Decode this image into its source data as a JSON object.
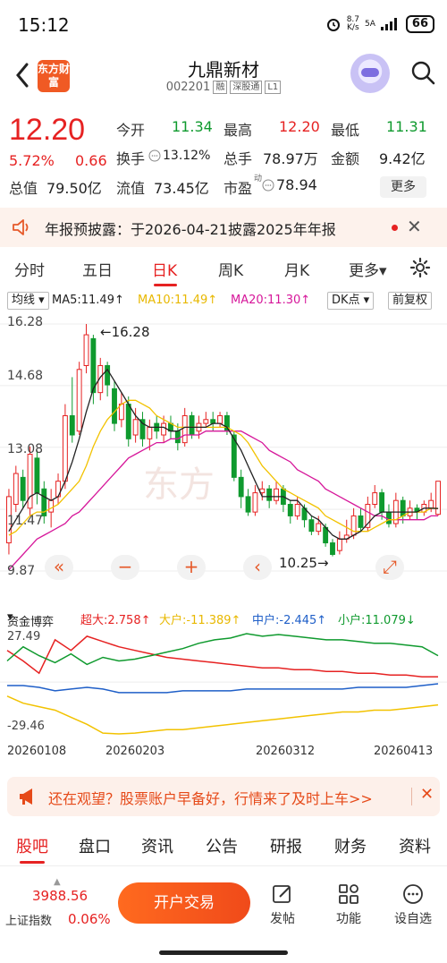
{
  "status_bar": {
    "time": "15:12",
    "net_speed_value": "8.7",
    "net_speed_unit": "K/s",
    "signal": "5A",
    "battery": "66"
  },
  "header": {
    "logo_text": "东方财富",
    "stock_name": "九鼎新材",
    "stock_code": "002201",
    "tags": [
      "融",
      "深股通",
      "L1"
    ]
  },
  "quote": {
    "price": "12.20",
    "change_pct": "5.72%",
    "change": "0.66",
    "total_cap_label": "总值",
    "total_cap": "79.50亿",
    "float_cap_label": "流值",
    "float_cap": "73.45亿",
    "open_label": "今开",
    "open": "11.34",
    "turnover_label": "换手",
    "turnover": "13.12%",
    "pe_label": "市盈",
    "pe_superscript": "动",
    "pe": "78.94",
    "high_label": "最高",
    "high": "12.20",
    "volume_label": "总手",
    "volume": "78.97万",
    "low_label": "最低",
    "low": "11.31",
    "amount_label": "金额",
    "amount": "9.42亿",
    "more_label": "更多"
  },
  "notice": {
    "text": "年报预披露：于2026-04-21披露2025年年报",
    "close_icon": "close-icon"
  },
  "chart_tabs": {
    "items": [
      "分时",
      "五日",
      "日K",
      "周K",
      "月K",
      "更多▾"
    ],
    "active": "日K"
  },
  "indicators": {
    "ma_type": "均线",
    "ma5": "MA5:11.49↑",
    "ma10": "MA10:11.49↑",
    "ma20": "MA20:11.30↑",
    "dk_label": "DK点",
    "adjust_label": "前复权"
  },
  "colors": {
    "up": "#e62222",
    "down": "#0f9a2e",
    "ma5": "#222222",
    "ma10": "#f2c200",
    "ma20": "#d6179a",
    "accent": "#f05a24"
  },
  "kline_axis": {
    "y_labels": [
      "16.28",
      "14.68",
      "13.08",
      "11.47",
      "9.87"
    ],
    "high_marker": "16.28",
    "low_marker": "10.25"
  },
  "chart_controls": [
    "«",
    "−",
    "+",
    "‹",
    "⤢"
  ],
  "fund_flow": {
    "title": "资金博弈",
    "super_large": "超大:2.758↑",
    "large": "大户:-11.389↑",
    "medium": "中户:-2.445↑",
    "small": "小户:11.079↓",
    "y_labels": [
      "27.49",
      "-29.46"
    ]
  },
  "dates": [
    "20260108",
    "20260203",
    "20260312",
    "20260413"
  ],
  "chart_data": [
    {
      "type": "candlestick",
      "title": "日K",
      "ylim": [
        9.87,
        16.28
      ],
      "y_ticks": [
        16.28,
        14.68,
        13.08,
        11.47,
        9.87
      ],
      "x_labels": [
        "20260108",
        "20260203",
        "20260312",
        "20260413"
      ],
      "annotations": [
        {
          "text": "16.28",
          "value": 16.28
        },
        {
          "text": "10.25",
          "value": 10.25
        }
      ],
      "candles": [
        {
          "o": 10.6,
          "c": 11.8,
          "h": 12.0,
          "l": 10.3
        },
        {
          "o": 11.6,
          "c": 12.4,
          "h": 12.6,
          "l": 11.4
        },
        {
          "o": 12.3,
          "c": 11.7,
          "h": 12.5,
          "l": 11.5
        },
        {
          "o": 11.5,
          "c": 12.9,
          "h": 13.1,
          "l": 11.3
        },
        {
          "o": 12.8,
          "c": 11.9,
          "h": 13.0,
          "l": 11.6
        },
        {
          "o": 12.0,
          "c": 11.3,
          "h": 12.2,
          "l": 11.1
        },
        {
          "o": 11.4,
          "c": 11.7,
          "h": 12.0,
          "l": 11.0
        },
        {
          "o": 11.8,
          "c": 12.2,
          "h": 12.4,
          "l": 11.6
        },
        {
          "o": 12.2,
          "c": 13.9,
          "h": 14.2,
          "l": 12.0
        },
        {
          "o": 13.9,
          "c": 13.4,
          "h": 14.9,
          "l": 13.2
        },
        {
          "o": 13.5,
          "c": 15.1,
          "h": 15.3,
          "l": 13.4
        },
        {
          "o": 15.2,
          "c": 16.0,
          "h": 16.28,
          "l": 15.0
        },
        {
          "o": 15.9,
          "c": 14.5,
          "h": 16.0,
          "l": 14.2
        },
        {
          "o": 14.5,
          "c": 15.2,
          "h": 15.4,
          "l": 14.3
        },
        {
          "o": 15.2,
          "c": 14.7,
          "h": 15.3,
          "l": 14.4
        },
        {
          "o": 14.6,
          "c": 13.7,
          "h": 14.8,
          "l": 13.5
        },
        {
          "o": 13.8,
          "c": 14.2,
          "h": 14.5,
          "l": 13.6
        },
        {
          "o": 14.2,
          "c": 13.3,
          "h": 14.4,
          "l": 13.1
        },
        {
          "o": 13.4,
          "c": 13.8,
          "h": 14.1,
          "l": 13.2
        },
        {
          "o": 13.8,
          "c": 13.3,
          "h": 14.0,
          "l": 13.1
        },
        {
          "o": 13.3,
          "c": 13.6,
          "h": 13.8,
          "l": 13.0
        },
        {
          "o": 13.7,
          "c": 13.5,
          "h": 13.9,
          "l": 13.3
        },
        {
          "o": 13.4,
          "c": 13.7,
          "h": 13.9,
          "l": 13.2
        },
        {
          "o": 13.7,
          "c": 13.5,
          "h": 13.9,
          "l": 13.3
        },
        {
          "o": 13.5,
          "c": 13.2,
          "h": 13.7,
          "l": 13.0
        },
        {
          "o": 13.2,
          "c": 13.9,
          "h": 14.1,
          "l": 13.1
        },
        {
          "o": 13.9,
          "c": 13.4,
          "h": 14.0,
          "l": 13.3
        },
        {
          "o": 13.5,
          "c": 13.7,
          "h": 13.9,
          "l": 13.3
        },
        {
          "o": 13.7,
          "c": 13.8,
          "h": 14.0,
          "l": 13.6
        },
        {
          "o": 13.8,
          "c": 13.7,
          "h": 14.0,
          "l": 13.5
        },
        {
          "o": 13.7,
          "c": 13.9,
          "h": 14.0,
          "l": 13.6
        },
        {
          "o": 13.9,
          "c": 13.5,
          "h": 14.0,
          "l": 13.4
        },
        {
          "o": 13.4,
          "c": 12.3,
          "h": 13.5,
          "l": 12.2
        },
        {
          "o": 12.3,
          "c": 11.8,
          "h": 12.5,
          "l": 11.5
        },
        {
          "o": 11.8,
          "c": 11.4,
          "h": 12.0,
          "l": 11.3
        },
        {
          "o": 11.4,
          "c": 11.9,
          "h": 12.1,
          "l": 11.3
        },
        {
          "o": 11.9,
          "c": 12.0,
          "h": 12.2,
          "l": 11.7
        },
        {
          "o": 12.0,
          "c": 11.7,
          "h": 12.1,
          "l": 11.5
        },
        {
          "o": 11.7,
          "c": 12.0,
          "h": 12.2,
          "l": 11.6
        },
        {
          "o": 12.0,
          "c": 11.6,
          "h": 12.1,
          "l": 11.4
        },
        {
          "o": 11.6,
          "c": 11.3,
          "h": 11.7,
          "l": 11.1
        },
        {
          "o": 11.3,
          "c": 11.6,
          "h": 11.8,
          "l": 11.2
        },
        {
          "o": 11.5,
          "c": 11.2,
          "h": 11.6,
          "l": 11.0
        },
        {
          "o": 11.2,
          "c": 10.9,
          "h": 11.3,
          "l": 10.8
        },
        {
          "o": 10.9,
          "c": 11.1,
          "h": 11.3,
          "l": 10.8
        },
        {
          "o": 11.0,
          "c": 10.6,
          "h": 11.1,
          "l": 10.5
        },
        {
          "o": 10.6,
          "c": 10.3,
          "h": 10.7,
          "l": 10.25
        },
        {
          "o": 10.4,
          "c": 10.7,
          "h": 10.9,
          "l": 10.3
        },
        {
          "o": 10.7,
          "c": 10.8,
          "h": 11.2,
          "l": 10.6
        },
        {
          "o": 10.8,
          "c": 11.3,
          "h": 11.5,
          "l": 10.7
        },
        {
          "o": 11.3,
          "c": 11.0,
          "h": 11.5,
          "l": 10.9
        },
        {
          "o": 11.0,
          "c": 11.6,
          "h": 11.8,
          "l": 10.9
        },
        {
          "o": 11.6,
          "c": 11.9,
          "h": 12.1,
          "l": 11.5
        },
        {
          "o": 11.9,
          "c": 11.4,
          "h": 12.0,
          "l": 11.2
        },
        {
          "o": 11.4,
          "c": 11.1,
          "h": 11.6,
          "l": 11.0
        },
        {
          "o": 11.1,
          "c": 11.7,
          "h": 11.9,
          "l": 11.0
        },
        {
          "o": 11.7,
          "c": 11.3,
          "h": 11.8,
          "l": 11.1
        },
        {
          "o": 11.3,
          "c": 11.5,
          "h": 11.7,
          "l": 11.2
        },
        {
          "o": 11.5,
          "c": 11.4,
          "h": 11.6,
          "l": 11.2
        },
        {
          "o": 11.4,
          "c": 11.6,
          "h": 11.7,
          "l": 11.3
        },
        {
          "o": 11.5,
          "c": 11.7,
          "h": 11.9,
          "l": 11.4
        },
        {
          "o": 11.34,
          "c": 12.2,
          "h": 12.2,
          "l": 11.31
        }
      ],
      "ma5": [
        10.9,
        11.2,
        11.5,
        11.8,
        11.9,
        11.8,
        11.7,
        11.8,
        12.2,
        12.7,
        13.3,
        14.0,
        14.6,
        14.9,
        15.1,
        14.8,
        14.5,
        14.2,
        13.9,
        13.7,
        13.6,
        13.6,
        13.6,
        13.5,
        13.5,
        13.6,
        13.6,
        13.6,
        13.6,
        13.7,
        13.7,
        13.6,
        13.3,
        13.0,
        12.6,
        12.2,
        11.8,
        11.8,
        11.8,
        11.8,
        11.7,
        11.7,
        11.5,
        11.3,
        11.2,
        11.0,
        10.8,
        10.7,
        10.7,
        10.8,
        10.9,
        11.1,
        11.3,
        11.4,
        11.4,
        11.4,
        11.4,
        11.4,
        11.4,
        11.5,
        11.5,
        11.49
      ],
      "ma10": [
        10.8,
        10.9,
        11.1,
        11.3,
        11.4,
        11.4,
        11.5,
        11.6,
        11.8,
        12.0,
        12.2,
        12.6,
        13.1,
        13.5,
        13.8,
        14.0,
        14.2,
        14.3,
        14.3,
        14.2,
        14.1,
        13.9,
        13.8,
        13.7,
        13.6,
        13.6,
        13.6,
        13.6,
        13.6,
        13.6,
        13.6,
        13.6,
        13.5,
        13.4,
        13.2,
        12.9,
        12.6,
        12.4,
        12.2,
        12.0,
        11.9,
        11.8,
        11.7,
        11.6,
        11.5,
        11.3,
        11.2,
        11.1,
        11.0,
        10.9,
        10.9,
        10.9,
        11.0,
        11.1,
        11.2,
        11.2,
        11.3,
        11.4,
        11.4,
        11.4,
        11.5,
        11.49
      ],
      "ma20": [
        9.9,
        10.1,
        10.3,
        10.5,
        10.7,
        10.8,
        10.9,
        11.0,
        11.1,
        11.3,
        11.4,
        11.6,
        11.8,
        12.0,
        12.2,
        12.4,
        12.6,
        12.8,
        12.9,
        13.0,
        13.1,
        13.2,
        13.2,
        13.3,
        13.3,
        13.4,
        13.4,
        13.4,
        13.5,
        13.5,
        13.5,
        13.5,
        13.5,
        13.5,
        13.4,
        13.3,
        13.2,
        13.0,
        12.9,
        12.8,
        12.7,
        12.5,
        12.4,
        12.3,
        12.2,
        12.0,
        11.9,
        11.8,
        11.7,
        11.6,
        11.5,
        11.4,
        11.3,
        11.3,
        11.2,
        11.2,
        11.2,
        11.2,
        11.2,
        11.2,
        11.3,
        11.3
      ]
    },
    {
      "type": "line",
      "title": "资金博弈",
      "ylim": [
        -29.46,
        27.49
      ],
      "series": [
        {
          "name": "超大",
          "color": "#e62222",
          "values": [
            18,
            12,
            5,
            24,
            18,
            26,
            23,
            20,
            18,
            16,
            14,
            13,
            12,
            11,
            10,
            9,
            8,
            8,
            7,
            7,
            6,
            6,
            5,
            5,
            4,
            4,
            3,
            3
          ]
        },
        {
          "name": "大户",
          "color": "#f2c200",
          "values": [
            -8,
            -12,
            -14,
            -16,
            -20,
            -24,
            -29,
            -29.46,
            -29,
            -28,
            -27,
            -27,
            -26,
            -25,
            -24,
            -23,
            -22,
            -21,
            -20,
            -19,
            -18,
            -17,
            -17,
            -16,
            -16,
            -15,
            -14,
            -13
          ]
        },
        {
          "name": "中户",
          "color": "#1f5fc8",
          "values": [
            -2,
            -2,
            -3,
            -5,
            -4,
            -3,
            -4,
            -6,
            -6,
            -6,
            -6,
            -5,
            -5,
            -5,
            -5,
            -4,
            -4,
            -4,
            -4,
            -4,
            -4,
            -4,
            -3,
            -3,
            -3,
            -3,
            -2,
            -1
          ]
        },
        {
          "name": "小户",
          "color": "#0f9a2e",
          "values": [
            12,
            20,
            15,
            11,
            16,
            10,
            14,
            12,
            13,
            15,
            17,
            19,
            22,
            24,
            25,
            27.49,
            26,
            27,
            26,
            25,
            24,
            24,
            23,
            22,
            22,
            21,
            20,
            15
          ]
        }
      ]
    }
  ],
  "ad": {
    "text": "还在观望？股票账户早备好，行情来了及时上车>>"
  },
  "bottom_tabs": {
    "items": [
      "股吧",
      "盘口",
      "资讯",
      "公告",
      "研报",
      "财务",
      "资料"
    ],
    "active": "股吧"
  },
  "toolbar": {
    "index_value": "3988.56",
    "index_arrow": "▲",
    "index_name": "上证指数",
    "index_pct": "0.06%",
    "trade_button": "开户交易",
    "post_label": "发帖",
    "func_label": "功能",
    "custom_label": "设自选"
  }
}
